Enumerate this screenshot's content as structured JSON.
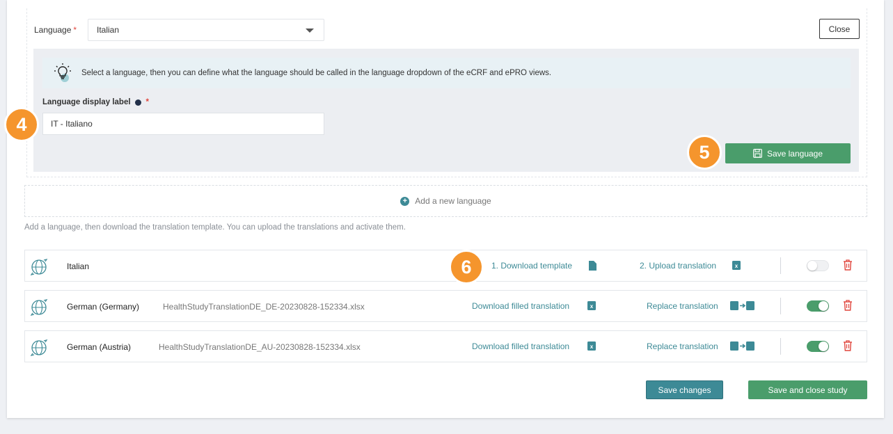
{
  "colors": {
    "accent_teal": "#3d8a96",
    "accent_green": "#4a9d6b",
    "required_red": "#e0453c",
    "step_orange": "#f5952d"
  },
  "form": {
    "language_label": "Language",
    "required_mark": "*",
    "language_value": "Italian",
    "close_label": "Close",
    "info_text": "Select a language, then you can define what the language should be called in the language dropdown of the eCRF and ePRO views.",
    "display_label": "Language display label",
    "display_value": "IT - Italiano",
    "save_language_label": "Save language"
  },
  "steps": {
    "s4": "4",
    "s5": "5",
    "s6": "6"
  },
  "add_language_label": "Add a new language",
  "helper_text": "Add a language, then download the translation template. You can upload the translations and activate them.",
  "languages": [
    {
      "name": "Italian",
      "file": "",
      "download_label": "1. Download template",
      "upload_label": "2. Upload translation",
      "active": false
    },
    {
      "name": "German (Germany)",
      "file": "HealthStudyTranslationDE_DE-20230828-152334.xlsx",
      "download_label": "Download filled translation",
      "upload_label": "Replace translation",
      "active": true
    },
    {
      "name": "German (Austria)",
      "file": "HealthStudyTranslationDE_AU-20230828-152334.xlsx",
      "download_label": "Download filled translation",
      "upload_label": "Replace translation",
      "active": true
    }
  ],
  "footer": {
    "save_changes_label": "Save changes",
    "save_close_label": "Save and close study"
  }
}
